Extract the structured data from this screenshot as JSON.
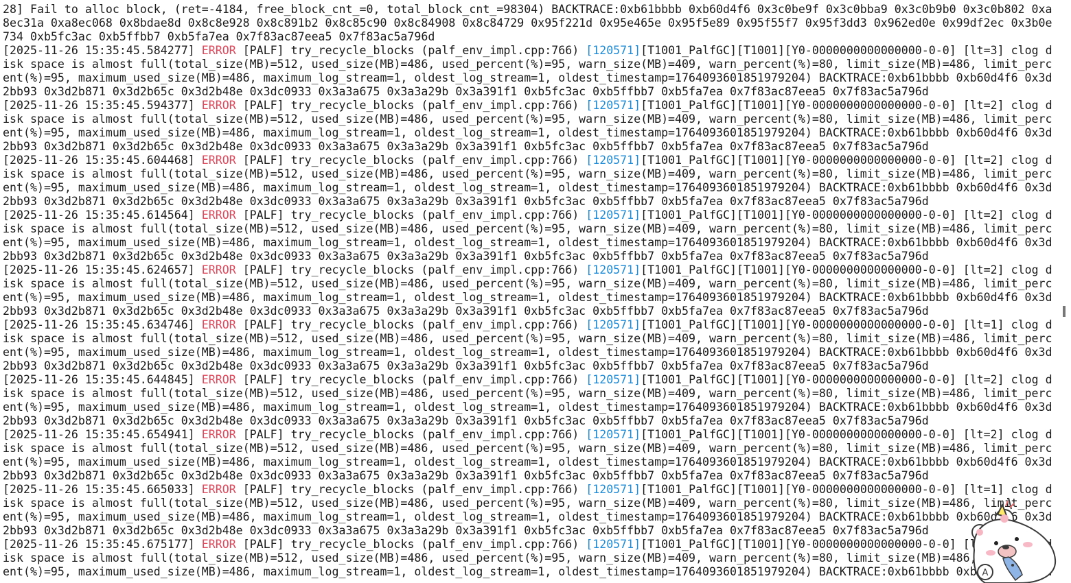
{
  "terminal": {
    "head_lines": [
      "28] Fail to alloc block, (ret=-4184, free_block_cnt_=0, total_block_cnt_=98304) BACKTRACE:0xb61bbbb 0xb60d4f6 0x3c0be9f 0x3c0bba9 0x3c0b9b0 0x3c0b802 0xa",
      "8ec31a 0xa8ec068 0x8bdae8d 0x8c8e928 0x8c891b2 0x8c85c90 0x8c84908 0x8c84729 0x95f221d 0x95e465e 0x95f5e89 0x95f55f7 0x95f3dd3 0x962ed0e 0x99df2ec 0x3b0e",
      "734 0xb5fc3ac 0xb5ffbb7 0xb5fa7ea 0x7f83ac87eea5 0x7f83ac5a796d"
    ],
    "entries": [
      {
        "ts": "[2025-11-26 15:35:45.584277]",
        "level": "ERROR",
        "mid": "[PALF] try_recycle_blocks (palf_env_impl.cpp:766)",
        "tid": "[120571]",
        "tail": "[T1001_PalfGC][T1001][Y0-0000000000000000-0-0] [lt=3] clog d",
        "cont": [
          "isk space is almost full(total_size(MB)=512, used_size(MB)=486, used_percent(%)=95, warn_size(MB)=409, warn_percent(%)=80, limit_size(MB)=486, limit_perc",
          "ent(%)=95, maximum_used_size(MB)=486, maximum_log_stream=1, oldest_log_stream=1, oldest_timestamp=1764093601851979204) BACKTRACE:0xb61bbbb 0xb60d4f6 0x3d",
          "2bb93 0x3d2b871 0x3d2b65c 0x3d2b48e 0x3dc0933 0x3a3a675 0x3a3a29b 0x3a391f1 0xb5fc3ac 0xb5ffbb7 0xb5fa7ea 0x7f83ac87eea5 0x7f83ac5a796d"
        ]
      },
      {
        "ts": "[2025-11-26 15:35:45.594377]",
        "level": "ERROR",
        "mid": "[PALF] try_recycle_blocks (palf_env_impl.cpp:766)",
        "tid": "[120571]",
        "tail": "[T1001_PalfGC][T1001][Y0-0000000000000000-0-0] [lt=2] clog d",
        "cont": [
          "isk space is almost full(total_size(MB)=512, used_size(MB)=486, used_percent(%)=95, warn_size(MB)=409, warn_percent(%)=80, limit_size(MB)=486, limit_perc",
          "ent(%)=95, maximum_used_size(MB)=486, maximum_log_stream=1, oldest_log_stream=1, oldest_timestamp=1764093601851979204) BACKTRACE:0xb61bbbb 0xb60d4f6 0x3d",
          "2bb93 0x3d2b871 0x3d2b65c 0x3d2b48e 0x3dc0933 0x3a3a675 0x3a3a29b 0x3a391f1 0xb5fc3ac 0xb5ffbb7 0xb5fa7ea 0x7f83ac87eea5 0x7f83ac5a796d"
        ]
      },
      {
        "ts": "[2025-11-26 15:35:45.604468]",
        "level": "ERROR",
        "mid": "[PALF] try_recycle_blocks (palf_env_impl.cpp:766)",
        "tid": "[120571]",
        "tail": "[T1001_PalfGC][T1001][Y0-0000000000000000-0-0] [lt=2] clog d",
        "cont": [
          "isk space is almost full(total_size(MB)=512, used_size(MB)=486, used_percent(%)=95, warn_size(MB)=409, warn_percent(%)=80, limit_size(MB)=486, limit_perc",
          "ent(%)=95, maximum_used_size(MB)=486, maximum_log_stream=1, oldest_log_stream=1, oldest_timestamp=1764093601851979204) BACKTRACE:0xb61bbbb 0xb60d4f6 0x3d",
          "2bb93 0x3d2b871 0x3d2b65c 0x3d2b48e 0x3dc0933 0x3a3a675 0x3a3a29b 0x3a391f1 0xb5fc3ac 0xb5ffbb7 0xb5fa7ea 0x7f83ac87eea5 0x7f83ac5a796d"
        ]
      },
      {
        "ts": "[2025-11-26 15:35:45.614564]",
        "level": "ERROR",
        "mid": "[PALF] try_recycle_blocks (palf_env_impl.cpp:766)",
        "tid": "[120571]",
        "tail": "[T1001_PalfGC][T1001][Y0-0000000000000000-0-0] [lt=2] clog d",
        "cont": [
          "isk space is almost full(total_size(MB)=512, used_size(MB)=486, used_percent(%)=95, warn_size(MB)=409, warn_percent(%)=80, limit_size(MB)=486, limit_perc",
          "ent(%)=95, maximum_used_size(MB)=486, maximum_log_stream=1, oldest_log_stream=1, oldest_timestamp=1764093601851979204) BACKTRACE:0xb61bbbb 0xb60d4f6 0x3d",
          "2bb93 0x3d2b871 0x3d2b65c 0x3d2b48e 0x3dc0933 0x3a3a675 0x3a3a29b 0x3a391f1 0xb5fc3ac 0xb5ffbb7 0xb5fa7ea 0x7f83ac87eea5 0x7f83ac5a796d"
        ]
      },
      {
        "ts": "[2025-11-26 15:35:45.624657]",
        "level": "ERROR",
        "mid": "[PALF] try_recycle_blocks (palf_env_impl.cpp:766)",
        "tid": "[120571]",
        "tail": "[T1001_PalfGC][T1001][Y0-0000000000000000-0-0] [lt=2] clog d",
        "cont": [
          "isk space is almost full(total_size(MB)=512, used_size(MB)=486, used_percent(%)=95, warn_size(MB)=409, warn_percent(%)=80, limit_size(MB)=486, limit_perc",
          "ent(%)=95, maximum_used_size(MB)=486, maximum_log_stream=1, oldest_log_stream=1, oldest_timestamp=1764093601851979204) BACKTRACE:0xb61bbbb 0xb60d4f6 0x3d",
          "2bb93 0x3d2b871 0x3d2b65c 0x3d2b48e 0x3dc0933 0x3a3a675 0x3a3a29b 0x3a391f1 0xb5fc3ac 0xb5ffbb7 0xb5fa7ea 0x7f83ac87eea5 0x7f83ac5a796d"
        ]
      },
      {
        "ts": "[2025-11-26 15:35:45.634746]",
        "level": "ERROR",
        "mid": "[PALF] try_recycle_blocks (palf_env_impl.cpp:766)",
        "tid": "[120571]",
        "tail": "[T1001_PalfGC][T1001][Y0-0000000000000000-0-0] [lt=1] clog d",
        "cont": [
          "isk space is almost full(total_size(MB)=512, used_size(MB)=486, used_percent(%)=95, warn_size(MB)=409, warn_percent(%)=80, limit_size(MB)=486, limit_perc",
          "ent(%)=95, maximum_used_size(MB)=486, maximum_log_stream=1, oldest_log_stream=1, oldest_timestamp=1764093601851979204) BACKTRACE:0xb61bbbb 0xb60d4f6 0x3d",
          "2bb93 0x3d2b871 0x3d2b65c 0x3d2b48e 0x3dc0933 0x3a3a675 0x3a3a29b 0x3a391f1 0xb5fc3ac 0xb5ffbb7 0xb5fa7ea 0x7f83ac87eea5 0x7f83ac5a796d"
        ]
      },
      {
        "ts": "[2025-11-26 15:35:45.644845]",
        "level": "ERROR",
        "mid": "[PALF] try_recycle_blocks (palf_env_impl.cpp:766)",
        "tid": "[120571]",
        "tail": "[T1001_PalfGC][T1001][Y0-0000000000000000-0-0] [lt=2] clog d",
        "cont": [
          "isk space is almost full(total_size(MB)=512, used_size(MB)=486, used_percent(%)=95, warn_size(MB)=409, warn_percent(%)=80, limit_size(MB)=486, limit_perc",
          "ent(%)=95, maximum_used_size(MB)=486, maximum_log_stream=1, oldest_log_stream=1, oldest_timestamp=1764093601851979204) BACKTRACE:0xb61bbbb 0xb60d4f6 0x3d",
          "2bb93 0x3d2b871 0x3d2b65c 0x3d2b48e 0x3dc0933 0x3a3a675 0x3a3a29b 0x3a391f1 0xb5fc3ac 0xb5ffbb7 0xb5fa7ea 0x7f83ac87eea5 0x7f83ac5a796d"
        ]
      },
      {
        "ts": "[2025-11-26 15:35:45.654941]",
        "level": "ERROR",
        "mid": "[PALF] try_recycle_blocks (palf_env_impl.cpp:766)",
        "tid": "[120571]",
        "tail": "[T1001_PalfGC][T1001][Y0-0000000000000000-0-0] [lt=2] clog d",
        "cont": [
          "isk space is almost full(total_size(MB)=512, used_size(MB)=486, used_percent(%)=95, warn_size(MB)=409, warn_percent(%)=80, limit_size(MB)=486, limit_perc",
          "ent(%)=95, maximum_used_size(MB)=486, maximum_log_stream=1, oldest_log_stream=1, oldest_timestamp=1764093601851979204) BACKTRACE:0xb61bbbb 0xb60d4f6 0x3d",
          "2bb93 0x3d2b871 0x3d2b65c 0x3d2b48e 0x3dc0933 0x3a3a675 0x3a3a29b 0x3a391f1 0xb5fc3ac 0xb5ffbb7 0xb5fa7ea 0x7f83ac87eea5 0x7f83ac5a796d"
        ]
      },
      {
        "ts": "[2025-11-26 15:35:45.665033]",
        "level": "ERROR",
        "mid": "[PALF] try_recycle_blocks (palf_env_impl.cpp:766)",
        "tid": "[120571]",
        "tail": "[T1001_PalfGC][T1001][Y0-0000000000000000-0-0] [lt=1] clog d",
        "cont": [
          "isk space is almost full(total_size(MB)=512, used_size(MB)=486, used_percent(%)=95, warn_size(MB)=409, warn_percent(%)=80, limit_size(MB)=486, limit_perc",
          "ent(%)=95, maximum_used_size(MB)=486, maximum_log_stream=1, oldest_log_stream=1, oldest_timestamp=1764093601851979204) BACKTRACE:0xb61bbbb 0xb60d4f6 0x3d",
          "2bb93 0x3d2b871 0x3d2b65c 0x3d2b48e 0x3dc0933 0x3a3a675 0x3a3a29b 0x3a391f1 0xb5fc3ac 0xb5ffbb7 0xb5fa7ea 0x7f83ac87eea5 0x7f83ac5a796d"
        ]
      },
      {
        "ts": "[2025-11-26 15:35:45.675177]",
        "level": "ERROR",
        "mid": "[PALF] try_recycle_blocks (palf_env_impl.cpp:766)",
        "tid": "[120571]",
        "tail": "[T1001_PalfGC][T1001][Y0-0000000000000000-0-0] [lt=2] clog d",
        "cont": [
          "isk space is almost full(total_size(MB)=512, used_size(MB)=486, used_percent(%)=95, warn_size(MB)=409, warn_percent(%)=80, limit_size(MB)=486, limit_perc",
          "ent(%)=95, maximum_used_size(MB)=486, maximum_log_stream=1, oldest_log_stream=1, oldest_timestamp=1764093601851979204) BACKTRACE:0xb61bbbb 0xb60d4f6 0x3d"
        ]
      }
    ]
  },
  "colors": {
    "background": "#ffffff",
    "text": "#1b1b1b",
    "error_level": "#e0475a",
    "thread_id": "#1f8bd6"
  },
  "overlay": {
    "icon": "bear-mascot-sticker-icon"
  }
}
